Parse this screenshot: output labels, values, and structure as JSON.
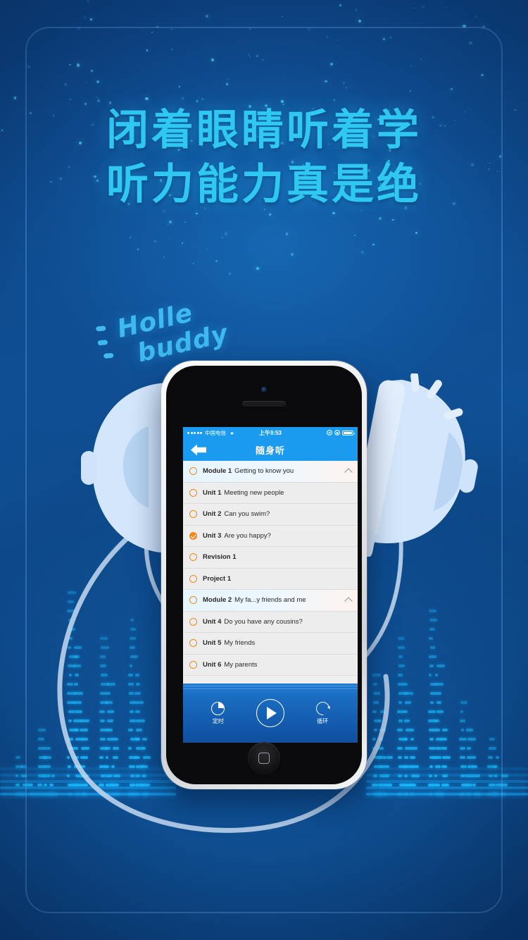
{
  "poster": {
    "headline_line1": "闭着眼睛听着学",
    "headline_line2": "听力能力真是绝",
    "sticker_line1": "Holle",
    "sticker_line2": "buddy",
    "accent_color": "#2fc8f3",
    "background_color": "#0d4b8f"
  },
  "phone": {
    "status_bar": {
      "carrier": "中国电信",
      "time": "上午9:53",
      "wifi_icon": "wifi-icon",
      "location_icon": "location-arrow-icon",
      "lock_icon": "rotation-lock-icon",
      "battery_icon": "battery-icon"
    },
    "nav_bar": {
      "title": "随身听",
      "back_icon": "back-arrow-icon"
    },
    "list": [
      {
        "type": "module",
        "prefix": "Module 1",
        "title": "Getting to know you",
        "checked": false,
        "expanded": true
      },
      {
        "type": "unit",
        "prefix": "Unit 1",
        "title": "Meeting new people",
        "checked": false
      },
      {
        "type": "unit",
        "prefix": "Unit 2",
        "title": "Can you swim?",
        "checked": false
      },
      {
        "type": "unit",
        "prefix": "Unit 3",
        "title": "Are you happy?",
        "checked": true
      },
      {
        "type": "unit",
        "prefix": "Revision 1",
        "title": "",
        "checked": false
      },
      {
        "type": "unit",
        "prefix": "Project 1",
        "title": "",
        "checked": false
      },
      {
        "type": "module",
        "prefix": "Module 2",
        "title": "My fa...y friends and me",
        "checked": false,
        "expanded": true
      },
      {
        "type": "unit",
        "prefix": "Unit 4",
        "title": "Do you have any cousins?",
        "checked": false
      },
      {
        "type": "unit",
        "prefix": "Unit 5",
        "title": "My friends",
        "checked": false
      },
      {
        "type": "unit",
        "prefix": "Unit 6",
        "title": "My parents",
        "checked": false
      }
    ],
    "player": {
      "timer_label": "定时",
      "timer_icon": "clock-icon",
      "play_label": "",
      "play_icon": "play-icon",
      "loop_label": "循环",
      "loop_icon": "loop-icon"
    },
    "home_button_icon": "home-button-icon"
  },
  "decor": {
    "left_headphone": "headphone-earcup-left",
    "right_headphone": "headphone-earcup-right",
    "equalizer": "audio-equalizer-bars",
    "cable": "headphone-cable"
  }
}
